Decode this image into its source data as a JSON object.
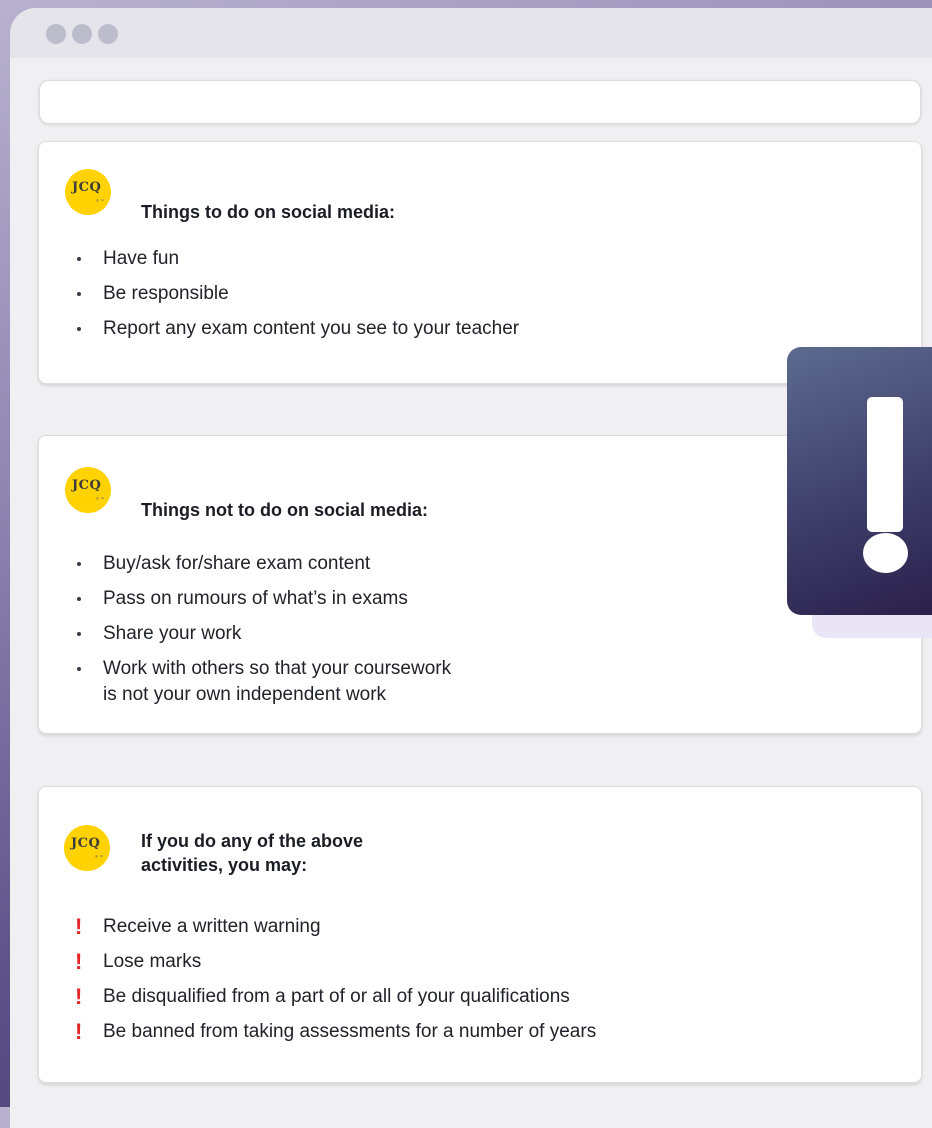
{
  "logo": {
    "text": "JCQ"
  },
  "sections": [
    {
      "title": "Things to do on social media:",
      "items": [
        "Have fun",
        "Be responsible",
        "Report any exam content you see to your teacher"
      ]
    },
    {
      "title": "Things not to do on social media:",
      "items": [
        "Buy/ask for/share exam content",
        "Pass on rumours of what’s in exams",
        "Share your work",
        "Work with others so that your coursework\nis not your own independent work"
      ]
    },
    {
      "title": "If you do any of the above\nactivities, you may:",
      "items": [
        "Receive a written warning",
        "Lose marks",
        "Be disqualified from a part of or all of your qualifications",
        "Be banned from taking assessments for a number of years"
      ]
    }
  ],
  "colors": {
    "logo": "#ffd200",
    "consequence_marker": "#e32527",
    "alert_panel": "#3e3f6a"
  },
  "icons": {
    "alert": "exclamation-icon",
    "consequence_marker": "exclamation-icon"
  }
}
